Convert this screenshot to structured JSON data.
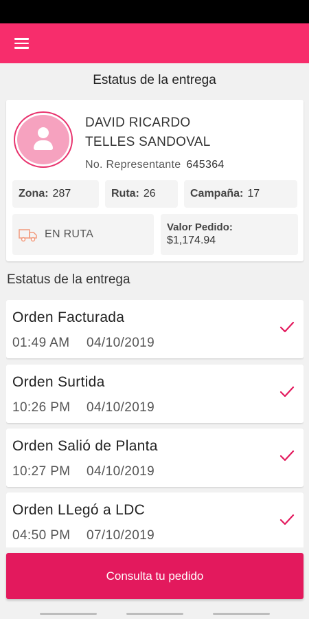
{
  "header": {
    "menu_icon": "hamburger-menu-icon",
    "color": "#f72d6c"
  },
  "page": {
    "title": "Estatus de la entrega"
  },
  "representative": {
    "name_line1": "DAVID RICARDO",
    "name_line2": "TELLES SANDOVAL",
    "number_label": "No. Representante",
    "number_value": "645364",
    "avatar_icon": "user-avatar-icon"
  },
  "details": {
    "zona_label": "Zona:",
    "zona_value": "287",
    "ruta_label": "Ruta:",
    "ruta_value": "26",
    "campana_label": "Campaña:",
    "campana_value": "17",
    "status_icon": "delivery-truck-icon",
    "status_text": "EN RUTA",
    "valor_label": "Valor Pedido:",
    "valor_value": "$1,174.94"
  },
  "timeline": {
    "section_title": "Estatus de la entrega",
    "items": [
      {
        "title": "Orden Facturada",
        "time": "01:49 AM",
        "date": "04/10/2019"
      },
      {
        "title": "Orden Surtida",
        "time": "10:26 PM",
        "date": "04/10/2019"
      },
      {
        "title": "Orden Salió de Planta",
        "time": "10:27 PM",
        "date": "04/10/2019"
      },
      {
        "title": "Orden LLegó a LDC",
        "time": "04:50 PM",
        "date": "07/10/2019"
      }
    ],
    "check_icon": "checkmark-icon",
    "check_color": "#e3195d"
  },
  "cta": {
    "label": "Consulta tu pedido",
    "color": "#e3195d"
  }
}
